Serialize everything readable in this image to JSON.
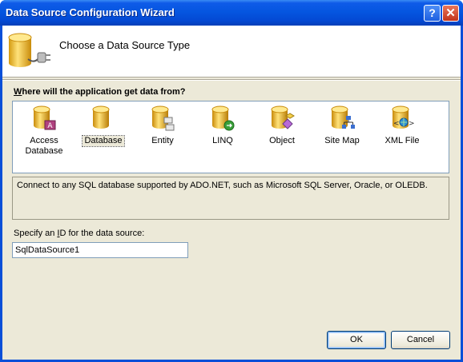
{
  "window": {
    "title": "Data Source Configuration Wizard",
    "help_glyph": "?",
    "close_glyph": "✕"
  },
  "header": {
    "title": "Choose a Data Source Type",
    "icon": "database-plug-icon"
  },
  "source_list": {
    "question_prefix": "",
    "question_accel": "W",
    "question_rest": "here will the application get data from?",
    "items": [
      {
        "line1": "Access",
        "line2": "Database",
        "icon": "access-database-icon"
      },
      {
        "line1": "Database",
        "line2": "",
        "icon": "database-icon",
        "selected": true
      },
      {
        "line1": "Entity",
        "line2": "",
        "icon": "entity-icon"
      },
      {
        "line1": "LINQ",
        "line2": "",
        "icon": "linq-icon"
      },
      {
        "line1": "Object",
        "line2": "",
        "icon": "object-icon"
      },
      {
        "line1": "Site Map",
        "line2": "",
        "icon": "site-map-icon"
      },
      {
        "line1": "XML File",
        "line2": "",
        "icon": "xml-file-icon"
      }
    ]
  },
  "description": "Connect to any SQL database supported by ADO.NET, such as Microsoft SQL Server, Oracle, or OLEDB.",
  "id_field": {
    "label_prefix": "Specify an ",
    "label_accel": "I",
    "label_rest": "D for the data source:",
    "value": "SqlDataSource1"
  },
  "buttons": {
    "ok": "OK",
    "cancel": "Cancel"
  },
  "colors": {
    "titlebar": "#0556e0",
    "dialog_bg": "#ece9d8",
    "cylinder": "#f0c030"
  }
}
